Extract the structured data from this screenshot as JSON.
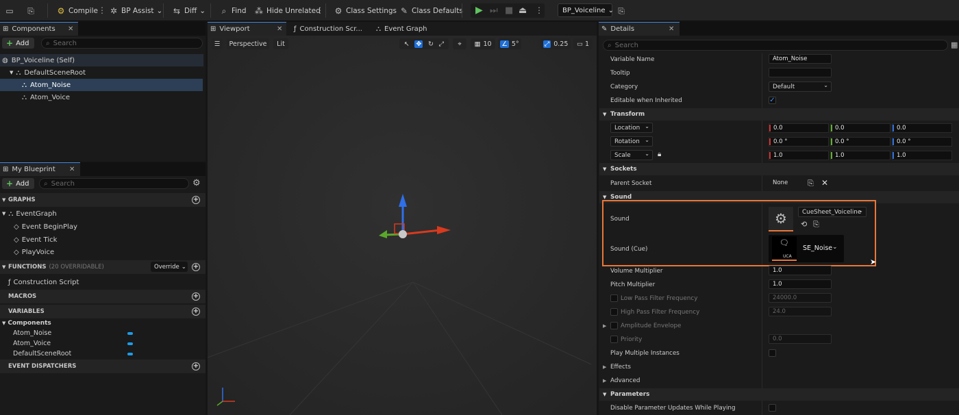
{
  "toolbar": {
    "compile": "Compile",
    "bp_assist": "BP Assist",
    "diff": "Diff",
    "find": "Find",
    "hide_unrelated": "Hide Unrelated",
    "class_settings": "Class Settings",
    "class_defaults": "Class Defaults",
    "blueprint_selector": "BP_Voiceline"
  },
  "components_panel": {
    "tab": "Components",
    "add_label": "Add",
    "search_placeholder": "Search",
    "tree": [
      "BP_Voiceline (Self)",
      "DefaultSceneRoot",
      "Atom_Noise",
      "Atom_Voice"
    ],
    "selected": "Atom_Noise"
  },
  "my_blueprint": {
    "tab": "My Blueprint",
    "add_label": "Add",
    "search_placeholder": "Search",
    "graphs_header": "GRAPHS",
    "event_graph": "EventGraph",
    "events": [
      "Event BeginPlay",
      "Event Tick",
      "PlayVoice"
    ],
    "functions_header": "FUNCTIONS",
    "functions_count": "(20 OVERRIDABLE)",
    "override_label": "Override",
    "construction_script": "Construction Script",
    "macros_header": "MACROS",
    "variables_header": "VARIABLES",
    "components_group": "Components",
    "variables": [
      "Atom_Noise",
      "Atom_Voice",
      "DefaultSceneRoot"
    ],
    "dispatchers_header": "EVENT DISPATCHERS"
  },
  "viewport": {
    "tabs": [
      "Viewport",
      "Construction Scr...",
      "Event Graph"
    ],
    "perspective": "Perspective",
    "lit": "Lit",
    "grid_snap": "10",
    "rot_snap": "5°",
    "scale_snap": "0.25",
    "cam_speed": "1"
  },
  "details": {
    "tab": "Details",
    "search_placeholder": "Search",
    "variable_name_label": "Variable Name",
    "variable_name": "Atom_Noise",
    "tooltip_label": "Tooltip",
    "category_label": "Category",
    "category_value": "Default",
    "editable_label": "Editable when Inherited",
    "transform_header": "Transform",
    "location_label": "Location",
    "location": [
      "0.0",
      "0.0",
      "0.0"
    ],
    "rotation_label": "Rotation",
    "rotation": [
      "0.0 °",
      "0.0 °",
      "0.0 °"
    ],
    "scale_label": "Scale",
    "scale": [
      "1.0",
      "1.0",
      "1.0"
    ],
    "sockets_header": "Sockets",
    "parent_socket_label": "Parent Socket",
    "parent_socket_value": "None",
    "sound_header": "Sound",
    "sound_label": "Sound",
    "sound_asset": "CueSheet_Voiceline",
    "sound_cue_label": "Sound (Cue)",
    "sound_cue_asset": "SE_Noise",
    "sound_cue_thumb_text": "UCA",
    "volume_label": "Volume Multiplier",
    "volume_value": "1.0",
    "pitch_label": "Pitch Multiplier",
    "pitch_value": "1.0",
    "lowpass_label": "Low Pass Filter Frequency",
    "lowpass_value": "24000.0",
    "highpass_label": "High Pass Filter Frequency",
    "highpass_value": "24.0",
    "amplitude_label": "Amplitude Envelope",
    "priority_label": "Priority",
    "priority_value": "0.0",
    "play_multiple_label": "Play Multiple Instances",
    "effects_label": "Effects",
    "advanced_label": "Advanced",
    "parameters_header": "Parameters",
    "disable_param_label": "Disable Parameter Updates While Playing"
  },
  "colors": {
    "highlight_box": "#e8773a",
    "selection": "#2c3f57",
    "accent_blue": "#1e9be8",
    "play_green": "#5fc35f"
  }
}
